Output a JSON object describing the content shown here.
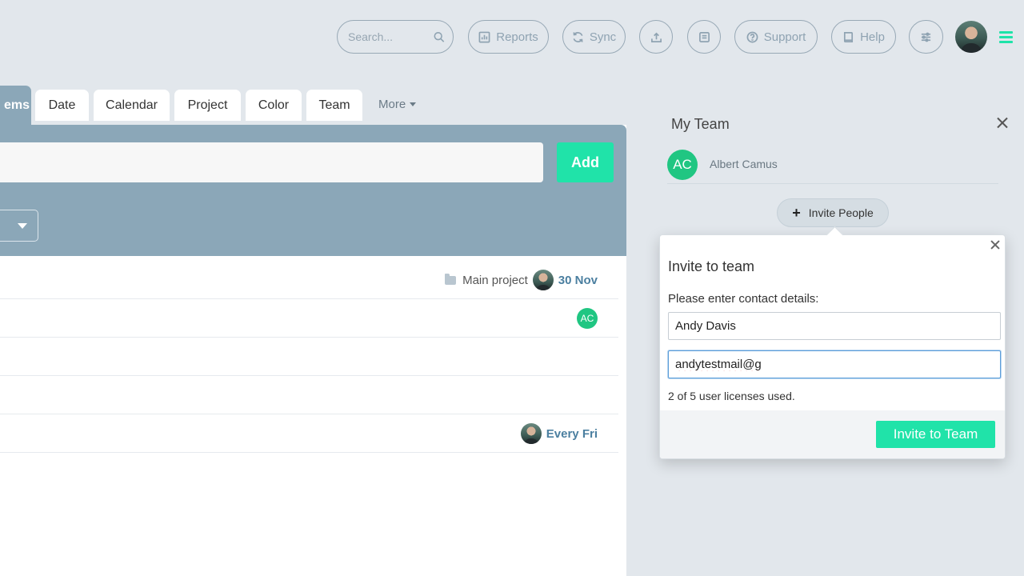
{
  "topbar": {
    "search_placeholder": "Search...",
    "reports_label": "Reports",
    "sync_label": "Sync",
    "support_label": "Support",
    "help_label": "Help"
  },
  "tabs": {
    "active_label": "ems",
    "items": [
      "Date",
      "Calendar",
      "Project",
      "Color",
      "Team"
    ],
    "more_label": "More"
  },
  "main": {
    "add_label": "Add",
    "rows": [
      {
        "project": "Main project",
        "date": "30 Nov"
      },
      {
        "badge": "AC"
      },
      {},
      {},
      {
        "date": "Every Fri"
      }
    ]
  },
  "team": {
    "title": "My Team",
    "members": [
      {
        "initials": "AC",
        "name": "Albert Camus",
        "color": "#20c682"
      }
    ],
    "invite_people_label": "Invite People"
  },
  "invite_popup": {
    "title": "Invite to team",
    "contact_label": "Please enter contact details:",
    "name_value": "Andy Davis",
    "email_value": "andytestmail@g",
    "license_text": "2 of 5 user licenses used.",
    "submit_label": "Invite to Team"
  },
  "colors": {
    "accent": "#20e3a9",
    "header": "#8ba7b8",
    "date_text": "#4b7fa0",
    "background": "#e2e7ec"
  }
}
